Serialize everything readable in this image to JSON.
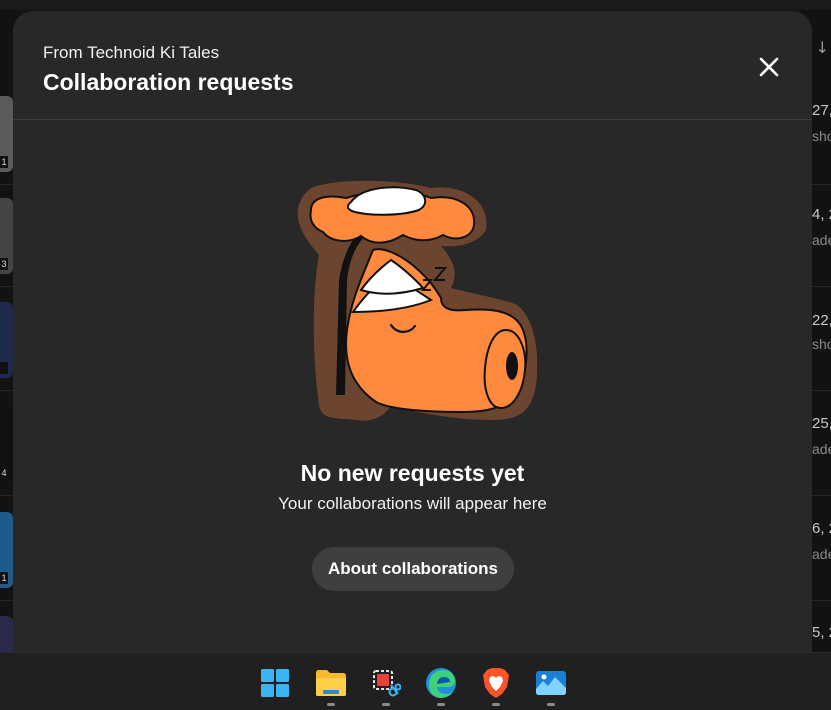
{
  "background": {
    "sort_arrow": "↓",
    "rows": [
      {
        "date": "27,",
        "sub": "sho",
        "badge": "1"
      },
      {
        "date": "4, 2",
        "sub": "ade",
        "badge": "3"
      },
      {
        "date": "22,",
        "sub": "sho",
        "badge": ""
      },
      {
        "date": "25,",
        "sub": "ade",
        "badge": "4"
      },
      {
        "date": "6, 2",
        "sub": "ade",
        "badge": "1"
      },
      {
        "date": "5, 2",
        "sub": "",
        "badge": ""
      }
    ]
  },
  "modal": {
    "subtitle": "From Technoid Ki Tales",
    "title": "Collaboration requests",
    "close_icon": "close-icon",
    "empty_state": {
      "illustration": "sleeping-character-illustration",
      "title": "No new requests yet",
      "subtitle": "Your collaborations will appear here"
    },
    "about_button_label": "About collaborations"
  },
  "taskbar": {
    "icons": [
      "windows-start-icon",
      "file-explorer-icon",
      "snipping-tool-icon",
      "edge-browser-icon",
      "brave-browser-icon",
      "photos-app-icon"
    ]
  },
  "colors": {
    "modal_bg": "#282828",
    "button_bg": "#3f3f3f",
    "illustration_orange": "#ff8a3d",
    "illustration_outline": "#6b4530"
  }
}
